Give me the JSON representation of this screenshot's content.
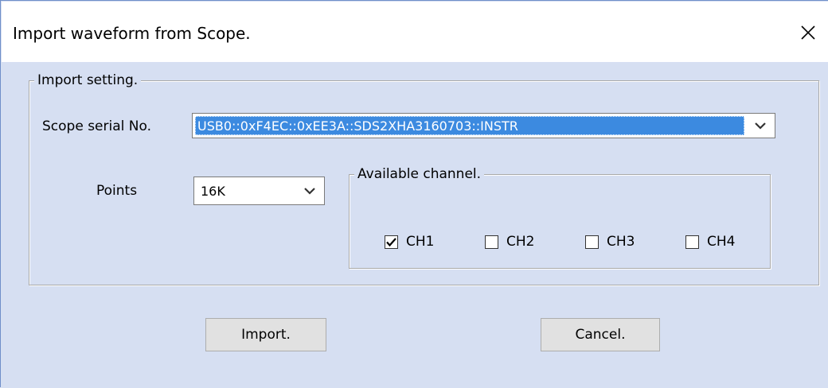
{
  "window": {
    "title": "Import waveform from Scope."
  },
  "import_setting": {
    "legend": "Import setting.",
    "serial_label": "Scope serial No.",
    "serial_value": "USB0::0xF4EC::0xEE3A::SDS2XHA3160703::INSTR",
    "points_label": "Points",
    "points_value": "16K"
  },
  "available_channel": {
    "legend": "Available channel.",
    "channels": [
      {
        "label": "CH1",
        "checked": true
      },
      {
        "label": "CH2",
        "checked": false
      },
      {
        "label": "CH3",
        "checked": false
      },
      {
        "label": "CH4",
        "checked": false
      }
    ]
  },
  "buttons": {
    "import_label": "Import.",
    "cancel_label": "Cancel."
  },
  "icons": {
    "close": "close-icon",
    "dropdown": "chevron-down-icon",
    "check": "checkmark-icon"
  },
  "colors": {
    "dialog_bg": "#d6dff2",
    "selection": "#3c8ae0",
    "window_border": "#6f8fc9"
  }
}
